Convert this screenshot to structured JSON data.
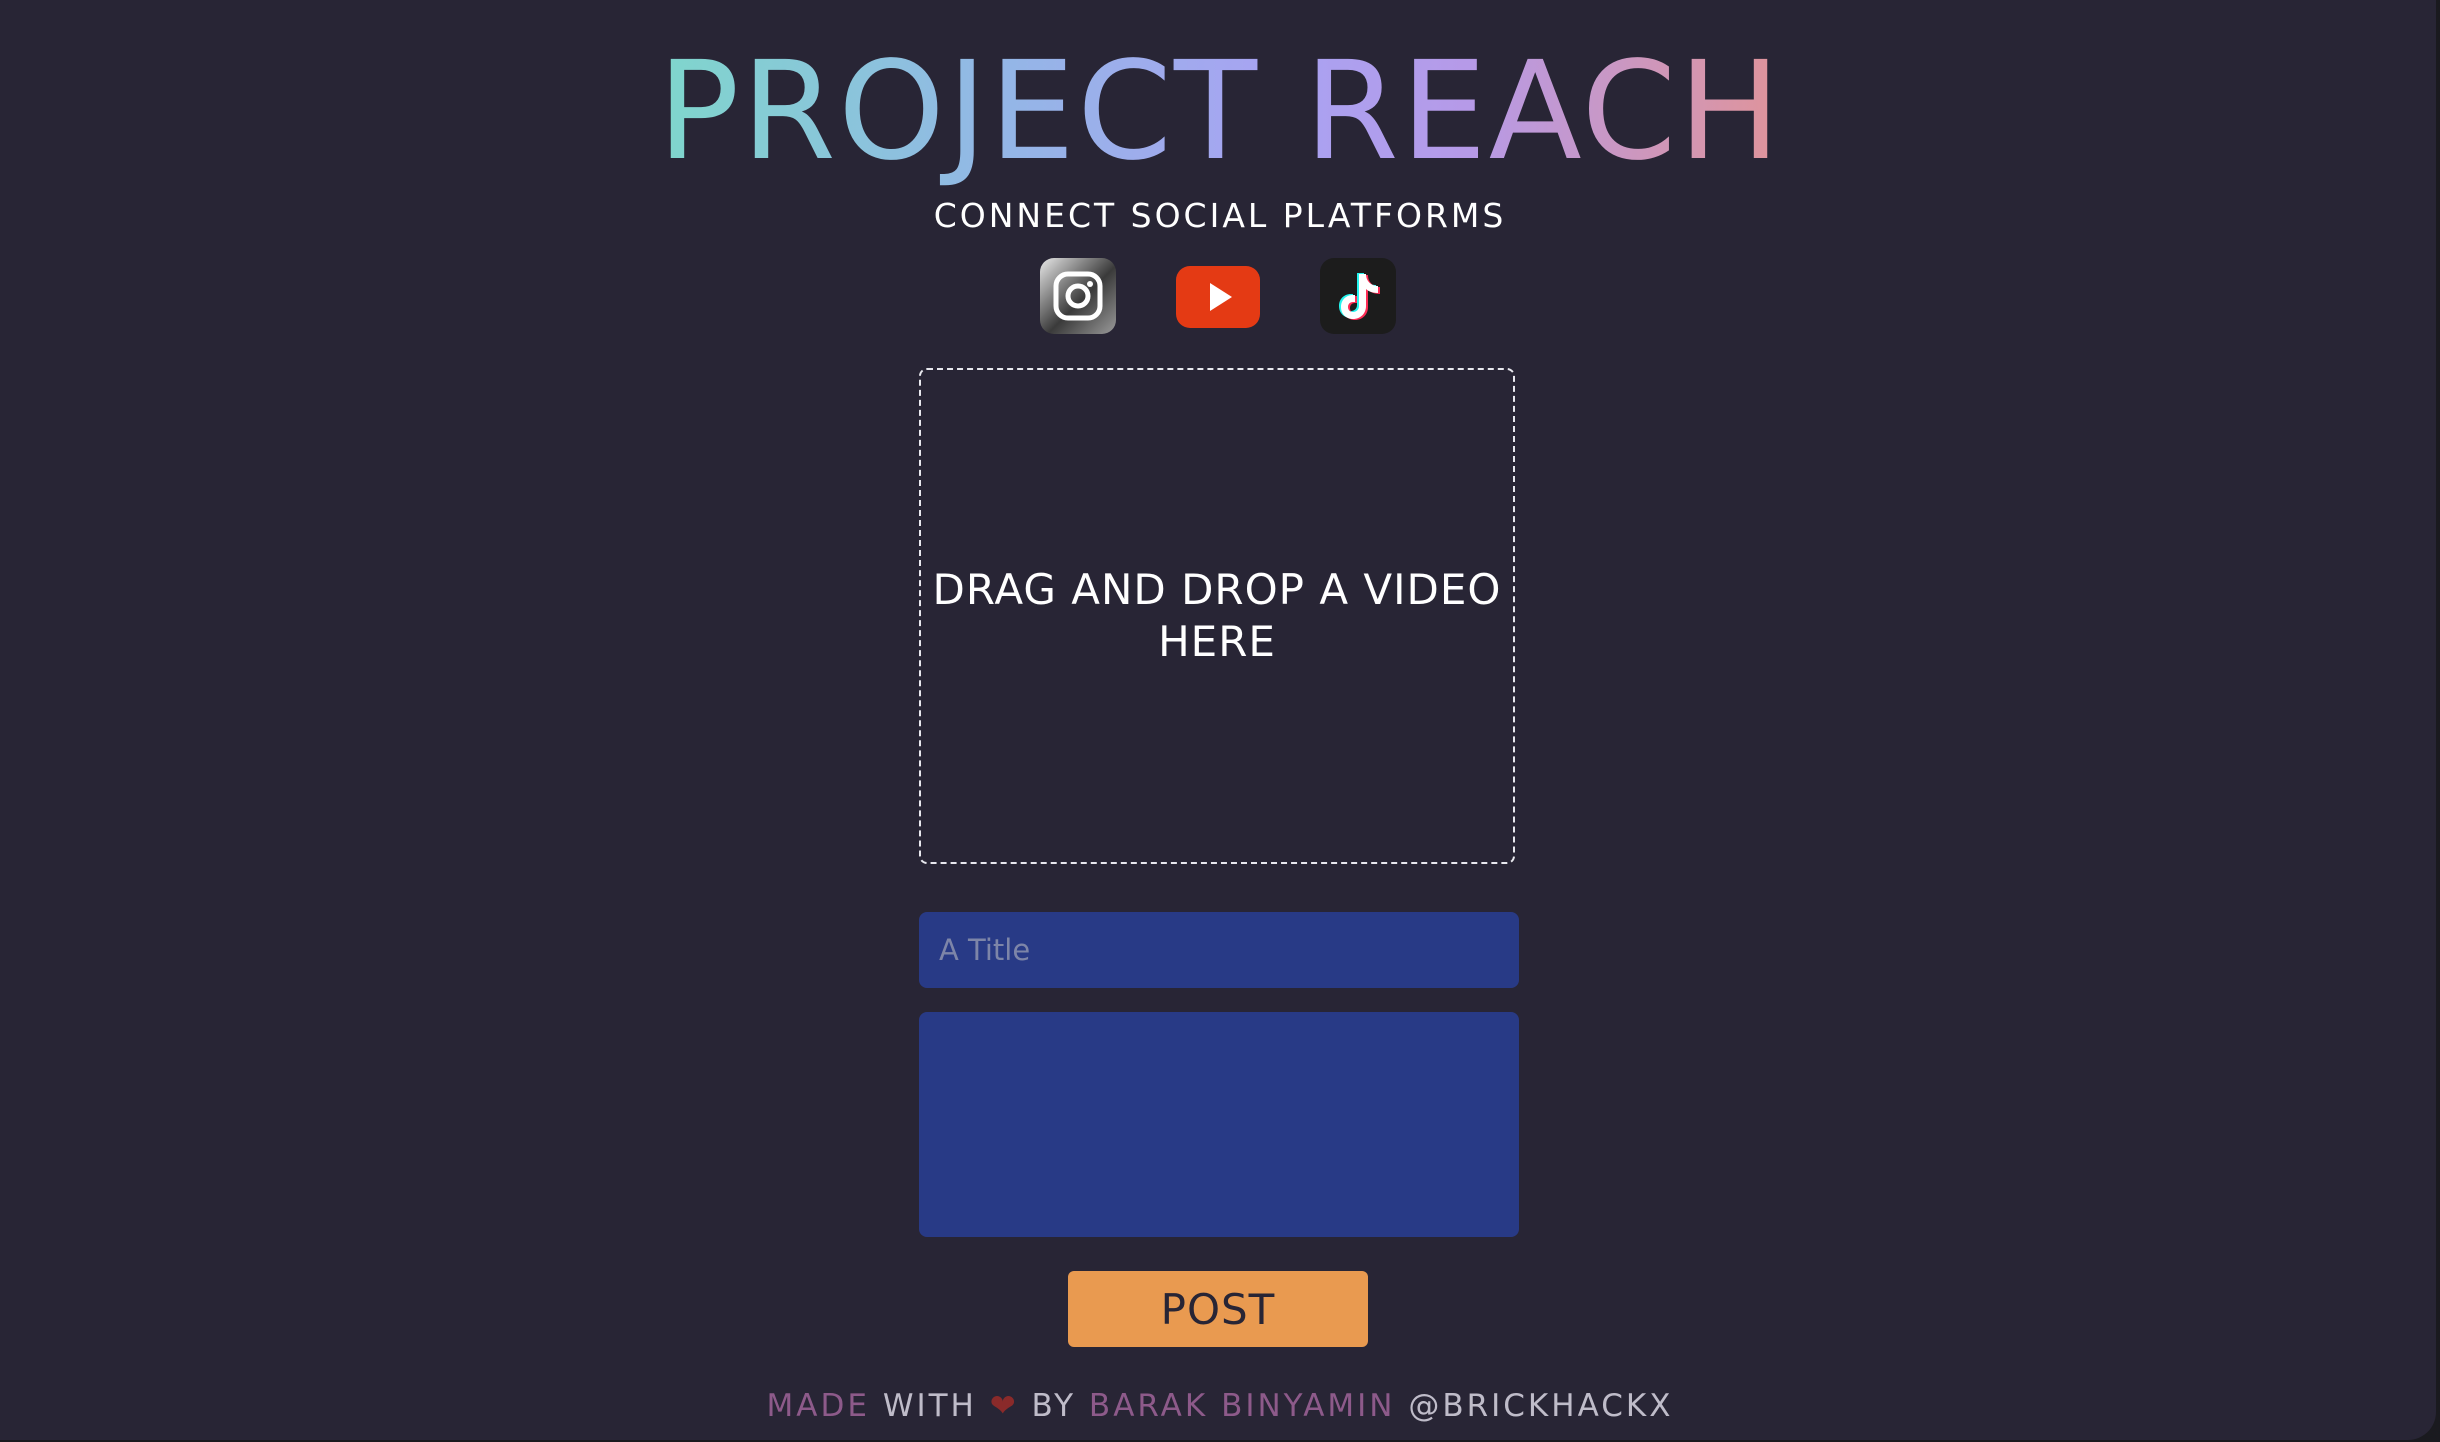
{
  "header": {
    "title": "PROJECT REACH",
    "subtitle": "CONNECT SOCIAL PLATFORMS"
  },
  "platforms": [
    {
      "name": "instagram",
      "icon": "instagram-icon",
      "color": "#3a3a3a"
    },
    {
      "name": "youtube",
      "icon": "youtube-icon",
      "color": "#e43a14"
    },
    {
      "name": "tiktok",
      "icon": "tiktok-icon",
      "color": "#1c1c1c"
    }
  ],
  "dropzone": {
    "label": "DRAG AND DROP A VIDEO HERE"
  },
  "form": {
    "title_placeholder": "A Title",
    "title_value": "",
    "description_value": "",
    "post_label": "POST"
  },
  "footer": {
    "made": "MADE",
    "with": " WITH ",
    "heart": "❤",
    "by": " BY ",
    "author": "BARAK BINYAMIN",
    "handle": " @BRICKHACKX"
  },
  "colors": {
    "background": "#282535",
    "input_bg": "#283a86",
    "accent_button": "#e99a50",
    "footer_accent": "#8d5a8a"
  }
}
